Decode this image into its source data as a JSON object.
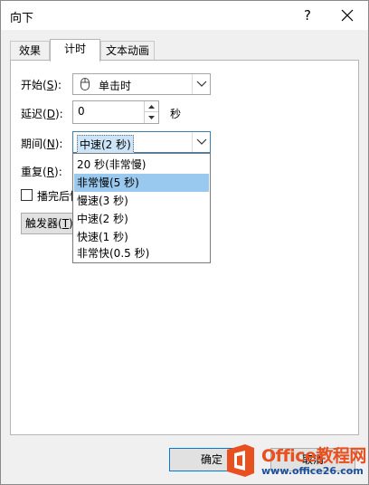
{
  "window": {
    "title": "向下",
    "help_glyph": "?",
    "close_glyph": "✕"
  },
  "tabs": [
    {
      "label": "效果"
    },
    {
      "label": "计时"
    },
    {
      "label": "文本动画"
    }
  ],
  "fields": {
    "start": {
      "label": "开始",
      "mnemonic": "(S):",
      "mnemonic_key": "S",
      "value": "单击时"
    },
    "delay": {
      "label": "延迟",
      "mnemonic_key": "D",
      "value": "0",
      "unit": "秒"
    },
    "duration": {
      "label": "期间",
      "mnemonic_key": "N",
      "value": "中速(2 秒)"
    },
    "repeat": {
      "label": "重复",
      "mnemonic_key": "R"
    },
    "rewind": {
      "label": "播完后快"
    }
  },
  "dropdown": {
    "options": [
      "20 秒(非常慢)",
      "非常慢(5 秒)",
      "慢速(3 秒)",
      "中速(2 秒)",
      "快速(1 秒)",
      "非常快(0.5 秒)"
    ],
    "highlighted": "非常慢(5 秒)"
  },
  "trigger_button": {
    "label": "触发器",
    "mnemonic_key": "T"
  },
  "ok_button": {
    "label": "确定"
  },
  "cancel_button": {
    "label": "取消"
  },
  "watermark": {
    "title_prefix": "Office",
    "title_suffix": "教程网",
    "url": "www.office26.com"
  },
  "colors": {
    "accent": "#0078d7",
    "highlight": "#99c9ef",
    "watermark_orange": "#e8501f"
  }
}
